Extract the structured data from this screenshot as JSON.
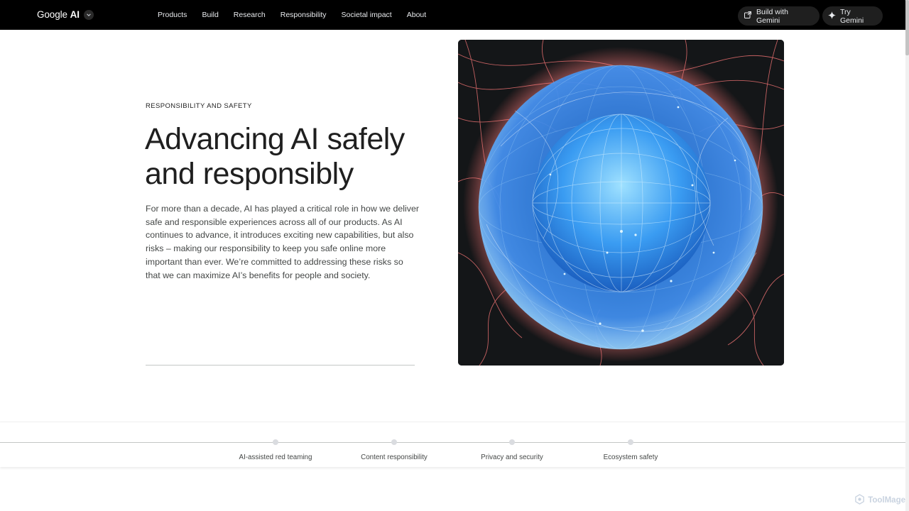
{
  "header": {
    "brand": {
      "word1": "Google",
      "word2": "AI"
    },
    "nav": [
      {
        "label": "Products"
      },
      {
        "label": "Build"
      },
      {
        "label": "Research"
      },
      {
        "label": "Responsibility"
      },
      {
        "label": "Societal impact"
      },
      {
        "label": "About"
      }
    ],
    "build_button": "Build with Gemini",
    "try_button": "Try Gemini"
  },
  "hero": {
    "eyebrow": "RESPONSIBILITY AND SAFETY",
    "title": "Advancing AI safely and responsibly",
    "body": "For more than a decade, AI has played a critical role in how we deliver safe and responsible experiences across all of our products. As AI continues to advance, it introduces exciting new capabilities, but also risks – making our responsibility to keep you safe online more important than ever. We’re committed to addressing these risks so that we can maximize AI’s benefits for people and society.",
    "image_icon": "glowing-sphere-image"
  },
  "tabs": [
    {
      "label": "AI-assisted red teaming"
    },
    {
      "label": "Content responsibility"
    },
    {
      "label": "Privacy and security"
    },
    {
      "label": "Ecosystem safety"
    }
  ],
  "watermark": "ToolMage",
  "colors": {
    "nav_bg": "#000000",
    "pill_bg": "#1f1f1f",
    "accent_blue": "#4aa8ff",
    "accent_red": "#ff6b6b"
  }
}
